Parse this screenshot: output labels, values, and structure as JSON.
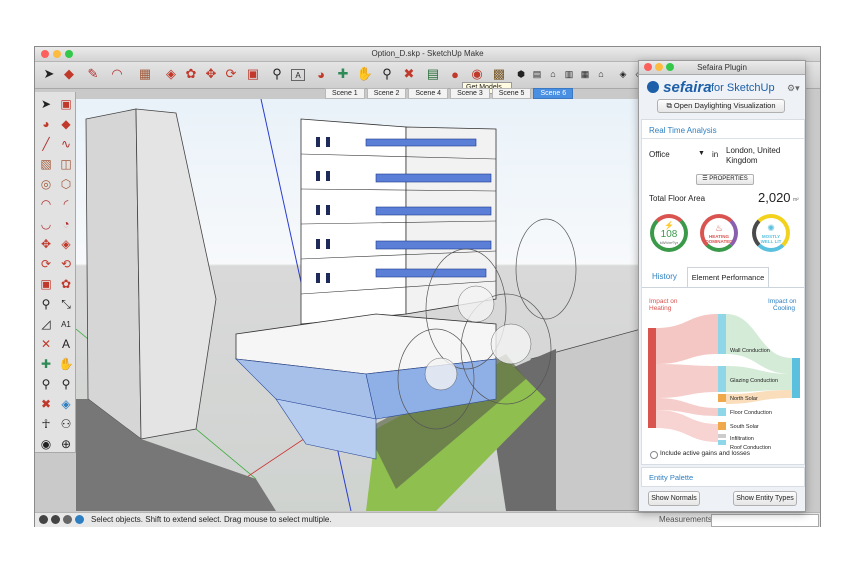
{
  "window": {
    "title": "Option_D.skp - SketchUp Make"
  },
  "tooltip": "Get Models...",
  "scenes": [
    "Scene 1",
    "Scene 2",
    "Scene 4",
    "Scene 3",
    "Scene 5",
    "Scene 6"
  ],
  "active_scene_index": 5,
  "status": {
    "message": "Select objects. Shift to extend select. Drag mouse to select multiple.",
    "measurements_label": "Measurements"
  },
  "plugin": {
    "title": "Sefaira Plugin",
    "brand": "sefaira",
    "brand_suffix": "for SketchUp",
    "open_daylighting_label": "Open Daylighting Visualization",
    "realtime_title": "Real Time Analysis",
    "building_type": "Office",
    "location_prep": "in",
    "location_line1": "London, United",
    "location_line2": "Kingdom",
    "properties_label": "PROPERTIES",
    "floor_area_label": "Total Floor Area",
    "floor_area_value": "2,020",
    "floor_area_unit": "m²",
    "eui_value": "108",
    "eui_unit": "kWh/m²/yr",
    "heating_line1": "HEATING",
    "heating_line2": "DOMINATED",
    "lit_line1": "MOSTLY",
    "lit_line2": "WELL LIT",
    "tabs": [
      "History",
      "Element Performance"
    ],
    "active_tab": 1,
    "impact_heating_line1": "Impact on",
    "impact_heating_line2": "Heating",
    "impact_cooling_line1": "Impact on",
    "impact_cooling_line2": "Cooling",
    "flows": [
      "Wall Conduction",
      "Glazing Conduction",
      "North Solar",
      "Floor Conduction",
      "South Solar",
      "Infiltration",
      "Roof Conduction"
    ],
    "include_label": "Include active gains and losses",
    "entity_palette": "Entity Palette",
    "show_normals": "Show Normals",
    "show_entity_types": "Show Entity Types"
  },
  "colors": {
    "heating": "#d9534f",
    "cooling": "#5bc0de",
    "accent": "#2d7fc1",
    "gauge_green": "#3a9a4a",
    "gauge_yellow": "#f2d21c"
  }
}
